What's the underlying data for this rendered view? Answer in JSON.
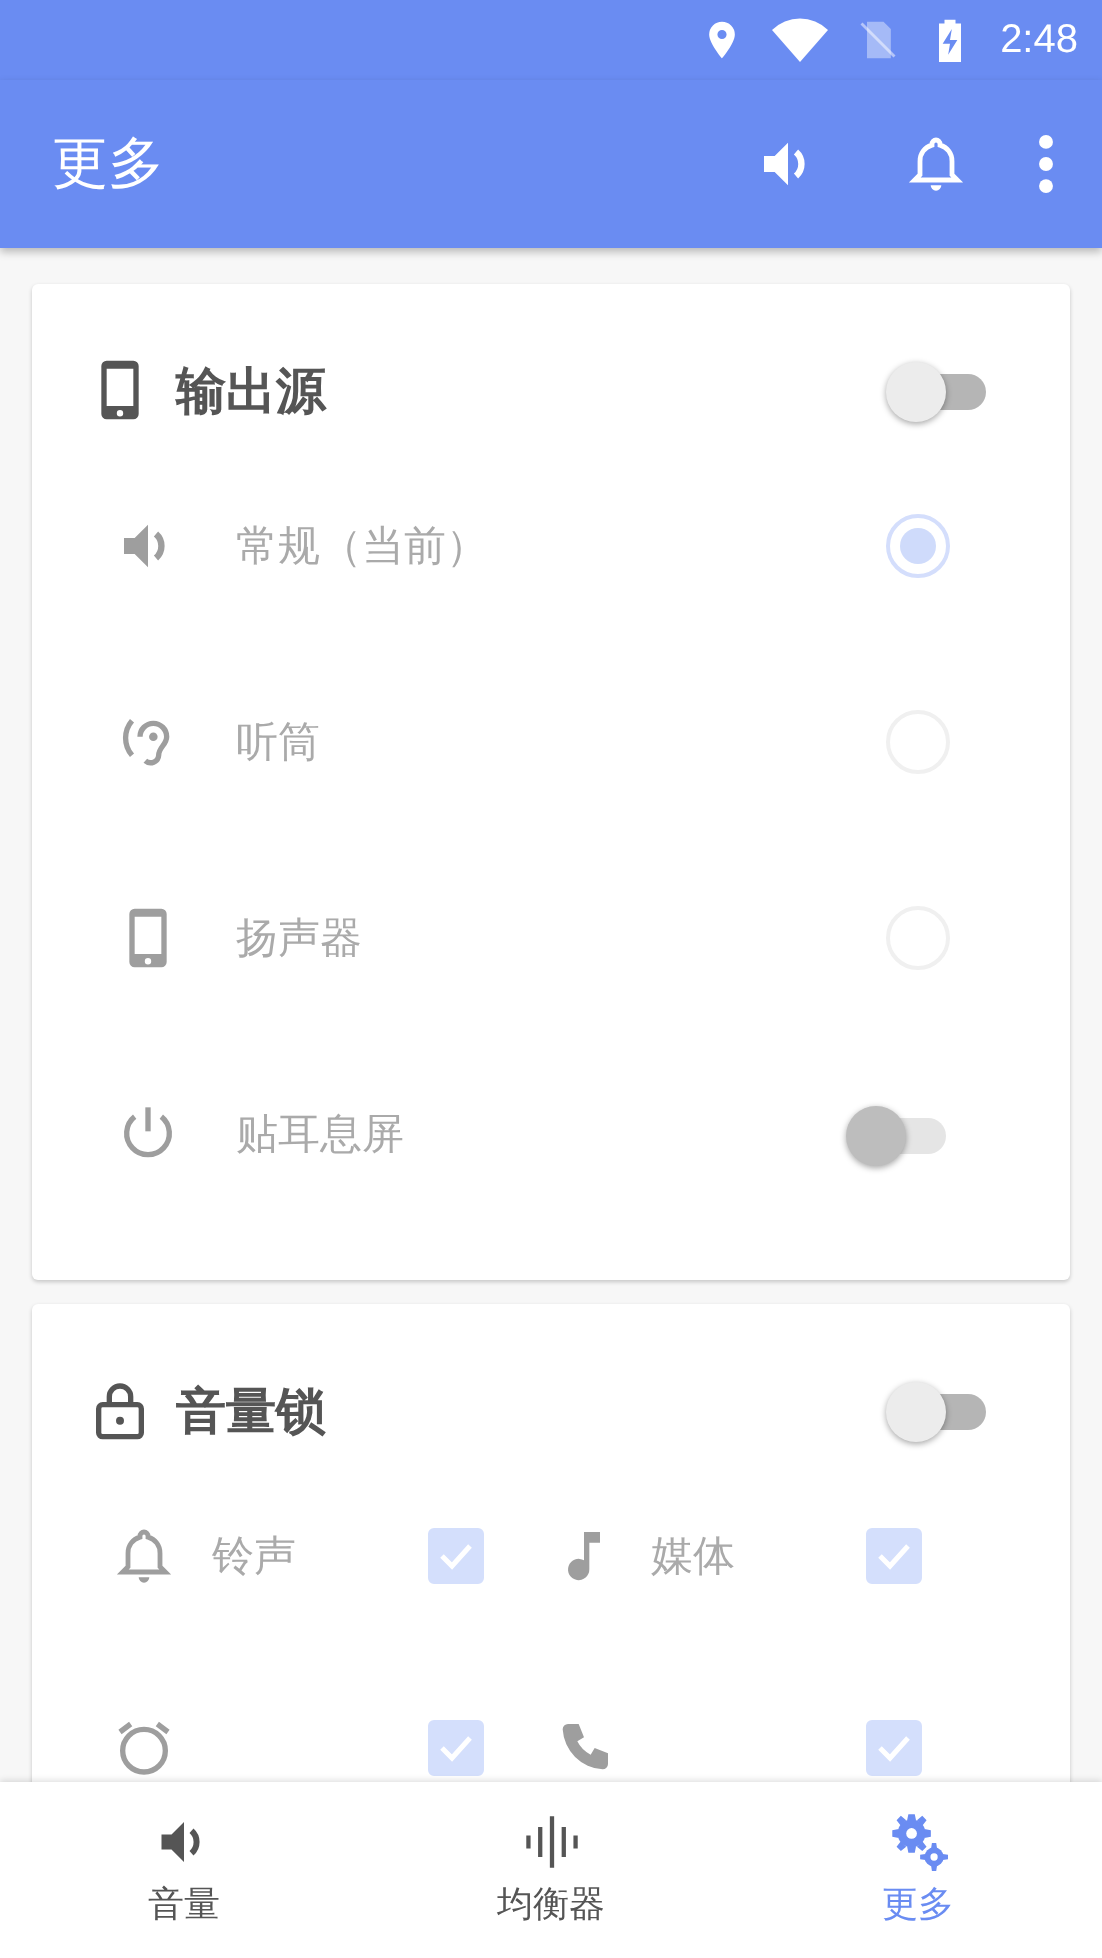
{
  "status_bar": {
    "time": "2:48"
  },
  "toolbar": {
    "title": "更多"
  },
  "sections": [
    {
      "title": "输出源",
      "on": false,
      "items": [
        {
          "kind": "radio",
          "label": "常规（当前）",
          "selected": true
        },
        {
          "kind": "radio",
          "label": "听筒",
          "selected": false
        },
        {
          "kind": "radio",
          "label": "扬声器",
          "selected": false
        },
        {
          "kind": "switch",
          "label": "贴耳息屏",
          "on": false
        }
      ]
    },
    {
      "title": "音量锁",
      "on": false,
      "items": [
        {
          "kind": "check",
          "label": "铃声",
          "checked": true
        },
        {
          "kind": "check",
          "label": "媒体",
          "checked": true
        },
        {
          "kind": "check",
          "checked": true
        },
        {
          "kind": "check",
          "checked": true
        }
      ]
    }
  ],
  "nav": [
    {
      "label": "音量",
      "selected": false
    },
    {
      "label": "均衡器",
      "selected": false
    },
    {
      "label": "更多",
      "selected": true
    }
  ]
}
